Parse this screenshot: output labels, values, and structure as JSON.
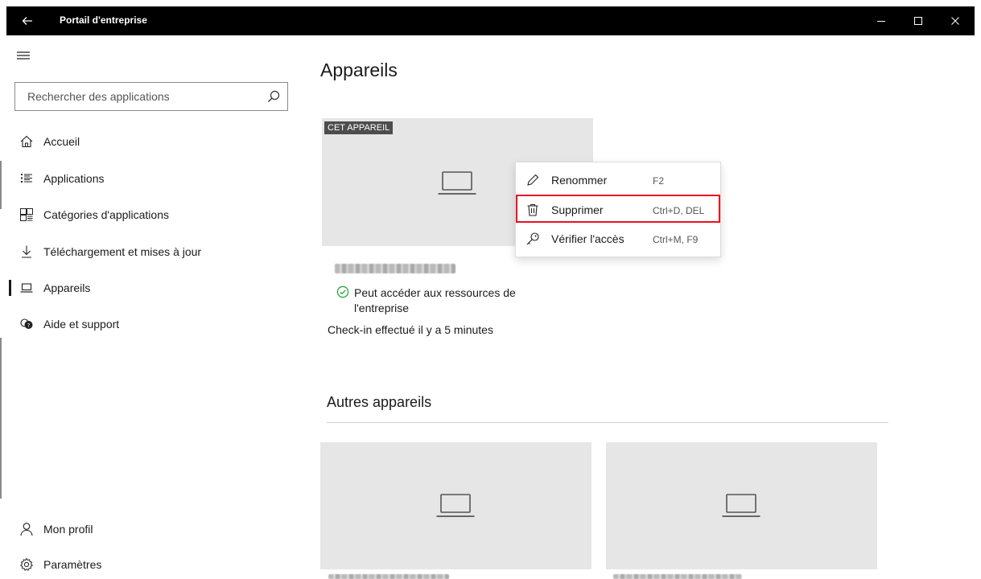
{
  "window": {
    "title": "Portail d'entreprise",
    "back_icon": "arrow-left-icon",
    "minimize_icon": "minimize-icon",
    "maximize_icon": "maximize-icon",
    "close_icon": "close-icon"
  },
  "sidebar": {
    "menu_icon": "hamburger-icon",
    "search": {
      "placeholder": "Rechercher des applications",
      "icon": "search-icon"
    },
    "nav": [
      {
        "label": "Accueil",
        "icon": "home-icon"
      },
      {
        "label": "Applications",
        "icon": "list-icon"
      },
      {
        "label": "Catégories d'applications",
        "icon": "categories-icon"
      },
      {
        "label": "Téléchargement et mises à jour",
        "icon": "download-icon"
      },
      {
        "label": "Appareils",
        "icon": "laptop-icon",
        "selected": true
      },
      {
        "label": "Aide et support",
        "icon": "help-icon"
      }
    ],
    "bottom": [
      {
        "label": "Mon profil",
        "icon": "person-icon"
      },
      {
        "label": "Paramètres",
        "icon": "gear-icon"
      }
    ]
  },
  "main": {
    "title": "Appareils",
    "this_device": {
      "tag": "CET APPAREIL",
      "icon": "laptop-icon",
      "status": "Peut accéder aux ressources de l'entreprise",
      "checkin": "Check-in effectué il y a 5 minutes"
    },
    "other_section_title": "Autres appareils",
    "other_devices": [
      {
        "icon": "laptop-icon"
      },
      {
        "icon": "laptop-icon"
      }
    ]
  },
  "context_menu": {
    "items": [
      {
        "label": "Renommer",
        "shortcut": "F2",
        "icon": "pencil-icon"
      },
      {
        "label": "Supprimer",
        "shortcut": "Ctrl+D, DEL",
        "icon": "trash-icon",
        "highlighted": true
      },
      {
        "label": "Vérifier l'accès",
        "shortcut": "Ctrl+M, F9",
        "icon": "key-icon"
      }
    ],
    "highlight_color": "#e81123"
  }
}
